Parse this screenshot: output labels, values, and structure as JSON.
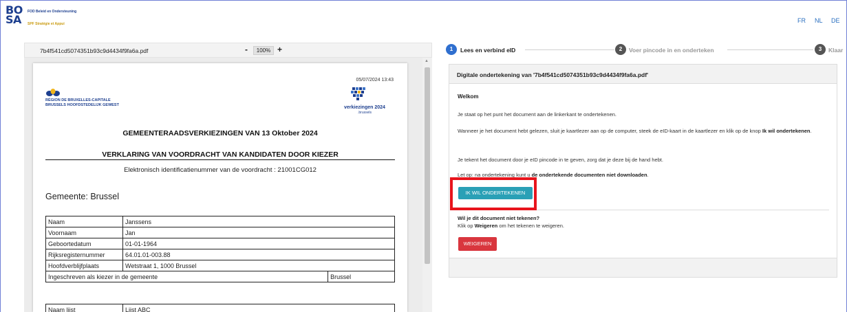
{
  "header": {
    "logo_mark_line1": "BO",
    "logo_mark_line2": "SA",
    "org_line1": "FOD Beleid en Ondersteuning",
    "org_line2": "SPF Stratégie et Appui",
    "languages": [
      "FR",
      "NL",
      "DE"
    ]
  },
  "pdf_viewer": {
    "filename": "7b4f541cd5074351b93c9d4434f9fa6a.pdf",
    "zoom_minus": "-",
    "zoom": "100%",
    "zoom_plus": "+",
    "scroll_up": "▲"
  },
  "document": {
    "date": "05/07/2024 13:43",
    "region_name_fr": "RÉGION DE BRUXELLES-CAPITALE",
    "region_name_nl": "BRUSSELS HOOFDSTEDELIJK GEWEST",
    "elections_logo_text": "verkiezingen 2024",
    "elections_logo_sub": ".brussels",
    "title": "GEMEENTERAADSVERKIEZINGEN VAN 13 Oktober 2024",
    "subtitle": "VERKLARING VAN VOORDRACHT VAN KANDIDATEN DOOR KIEZER",
    "identifier": "Elektronisch identificatienummer van de voordracht : 21001CG012",
    "municipality": "Gemeente: Brussel",
    "person": {
      "naam_label": "Naam",
      "naam": "Janssens",
      "voornaam_label": "Voornaam",
      "voornaam": "Jan",
      "geboortedatum_label": "Geboortedatum",
      "geboortedatum": "01-01-1964",
      "rijksregister_label": "Rijksregisternummer",
      "rijksregister": "64.01.01-003.88",
      "hoofdverblijf_label": "Hoofdverblijfplaats",
      "hoofdverblijf": "Wetstraat 1, 1000 Brussel",
      "ingeschreven_label": "Ingeschreven als kiezer in de gemeente",
      "ingeschreven": "Brussel"
    },
    "list": {
      "naam_lijst_label": "Naam lijst",
      "naam_lijst": "Lijst ABC"
    }
  },
  "stepper": {
    "steps": [
      {
        "number": "1",
        "label": "Lees en verbind eID"
      },
      {
        "number": "2",
        "label": "Voer pincode in en onderteken"
      },
      {
        "number": "3",
        "label": "Klaar"
      }
    ]
  },
  "panel": {
    "title": "Digitale ondertekening van '7b4f541cd5074351b93c9d4434f9fa6a.pdf'",
    "welcome": "Welkom",
    "p1": "Je staat op het punt het document aan de linkerkant te ondertekenen.",
    "p2_part1": "Wanneer je het document hebt gelezen, sluit je kaartlezer aan op de computer, steek de eID-kaart in de kaartlezer en klik op de knop ",
    "p2_bold": "Ik wil ondertekenen",
    "p2_end": ".",
    "p3": "Je tekent het document door je eID pincode in te geven, zorg dat je deze bij de hand hebt.",
    "p4_part1": "Let op: na ondertekening kunt u ",
    "p4_bold": "de ondertekende documenten niet downloaden",
    "p4_end": ".",
    "sign_button": "IK WIL ONDERTEKENEN",
    "refuse_heading": "Wil je dit document niet tekenen?",
    "refuse_part1": "Klik op ",
    "refuse_bold": "Weigeren",
    "refuse_part2": " om het tekenen te weigeren.",
    "refuse_button": "WEIGEREN"
  },
  "colors": {
    "step_active": "#2f6fcf",
    "step_inactive": "#555555",
    "sign_button": "#2aa0b6",
    "refuse_button": "#d9363e",
    "highlight": "#e8141c",
    "brand_blue": "#1d3f8f",
    "brand_yellow": "#f1b51c"
  }
}
